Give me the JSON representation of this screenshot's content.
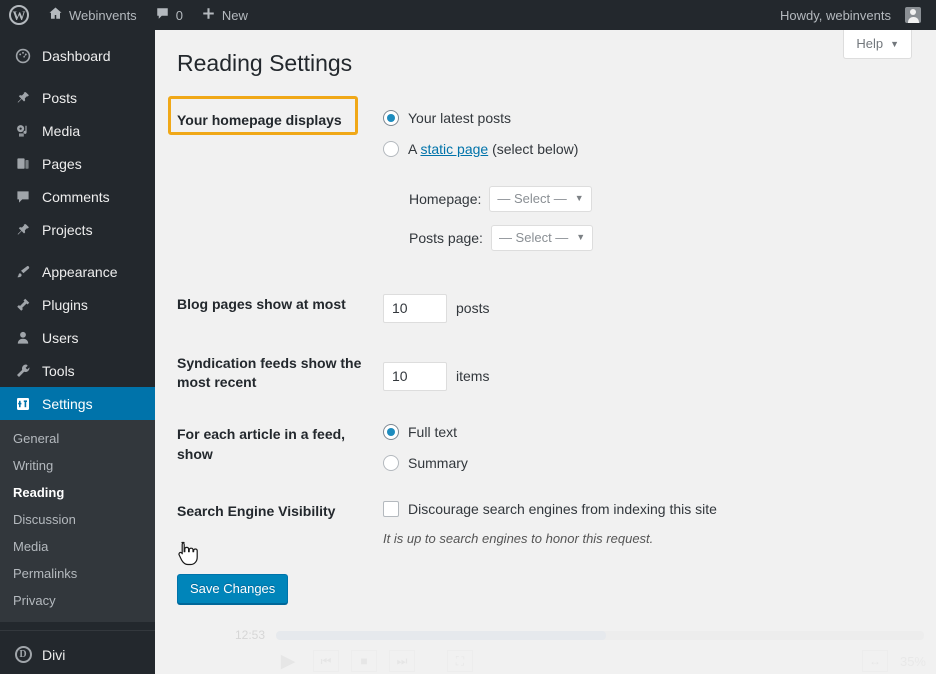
{
  "adminbar": {
    "logo_icon": "wordpress-logo-icon",
    "site_name": "Webinvents",
    "comments_count": "0",
    "new_label": "New",
    "howdy": "Howdy, webinvents"
  },
  "sidebar": {
    "items": [
      {
        "label": "Dashboard",
        "icon": "dashboard-icon",
        "current": false
      },
      {
        "label": "Posts",
        "icon": "pin-icon",
        "current": false
      },
      {
        "label": "Media",
        "icon": "media-icon",
        "current": false
      },
      {
        "label": "Pages",
        "icon": "pages-icon",
        "current": false
      },
      {
        "label": "Comments",
        "icon": "comment-icon",
        "current": false
      },
      {
        "label": "Projects",
        "icon": "pin-icon",
        "current": false
      },
      {
        "label": "Appearance",
        "icon": "brush-icon",
        "current": false
      },
      {
        "label": "Plugins",
        "icon": "plug-icon",
        "current": false
      },
      {
        "label": "Users",
        "icon": "user-icon",
        "current": false
      },
      {
        "label": "Tools",
        "icon": "wrench-icon",
        "current": false
      },
      {
        "label": "Settings",
        "icon": "settings-icon",
        "current": true
      }
    ],
    "submenu": [
      {
        "label": "General",
        "current": false
      },
      {
        "label": "Writing",
        "current": false
      },
      {
        "label": "Reading",
        "current": true
      },
      {
        "label": "Discussion",
        "current": false
      },
      {
        "label": "Media",
        "current": false
      },
      {
        "label": "Permalinks",
        "current": false
      },
      {
        "label": "Privacy",
        "current": false
      }
    ],
    "divi": {
      "label": "Divi",
      "icon": "divi-icon"
    },
    "active_color": "#0073aa",
    "background": "#23282d"
  },
  "content": {
    "help_label": "Help",
    "page_title": "Reading Settings",
    "rows": {
      "homepage": {
        "label": "Your homepage displays",
        "highlight_color": "#f0a818",
        "option_latest": "Your latest posts",
        "option_static_prefix": "A ",
        "option_static_link": "static page",
        "option_static_suffix": " (select below)",
        "homepage_label": "Homepage:",
        "homepage_value": "— Select —",
        "posts_page_label": "Posts page:",
        "posts_page_value": "— Select —"
      },
      "blog_pages": {
        "label": "Blog pages show at most",
        "value": "10",
        "unit": "posts"
      },
      "syndication": {
        "label": "Syndication feeds show the most recent",
        "value": "10",
        "unit": "items"
      },
      "feed_article": {
        "label": "For each article in a feed, show",
        "option_full": "Full text",
        "option_summary": "Summary"
      },
      "search_visibility": {
        "label": "Search Engine Visibility",
        "checkbox_label": "Discourage search engines from indexing this site",
        "hint": "It is up to search engines to honor this request."
      }
    },
    "save_label": "Save Changes"
  },
  "player": {
    "time": "12:53",
    "zoom_percent": "35%"
  }
}
